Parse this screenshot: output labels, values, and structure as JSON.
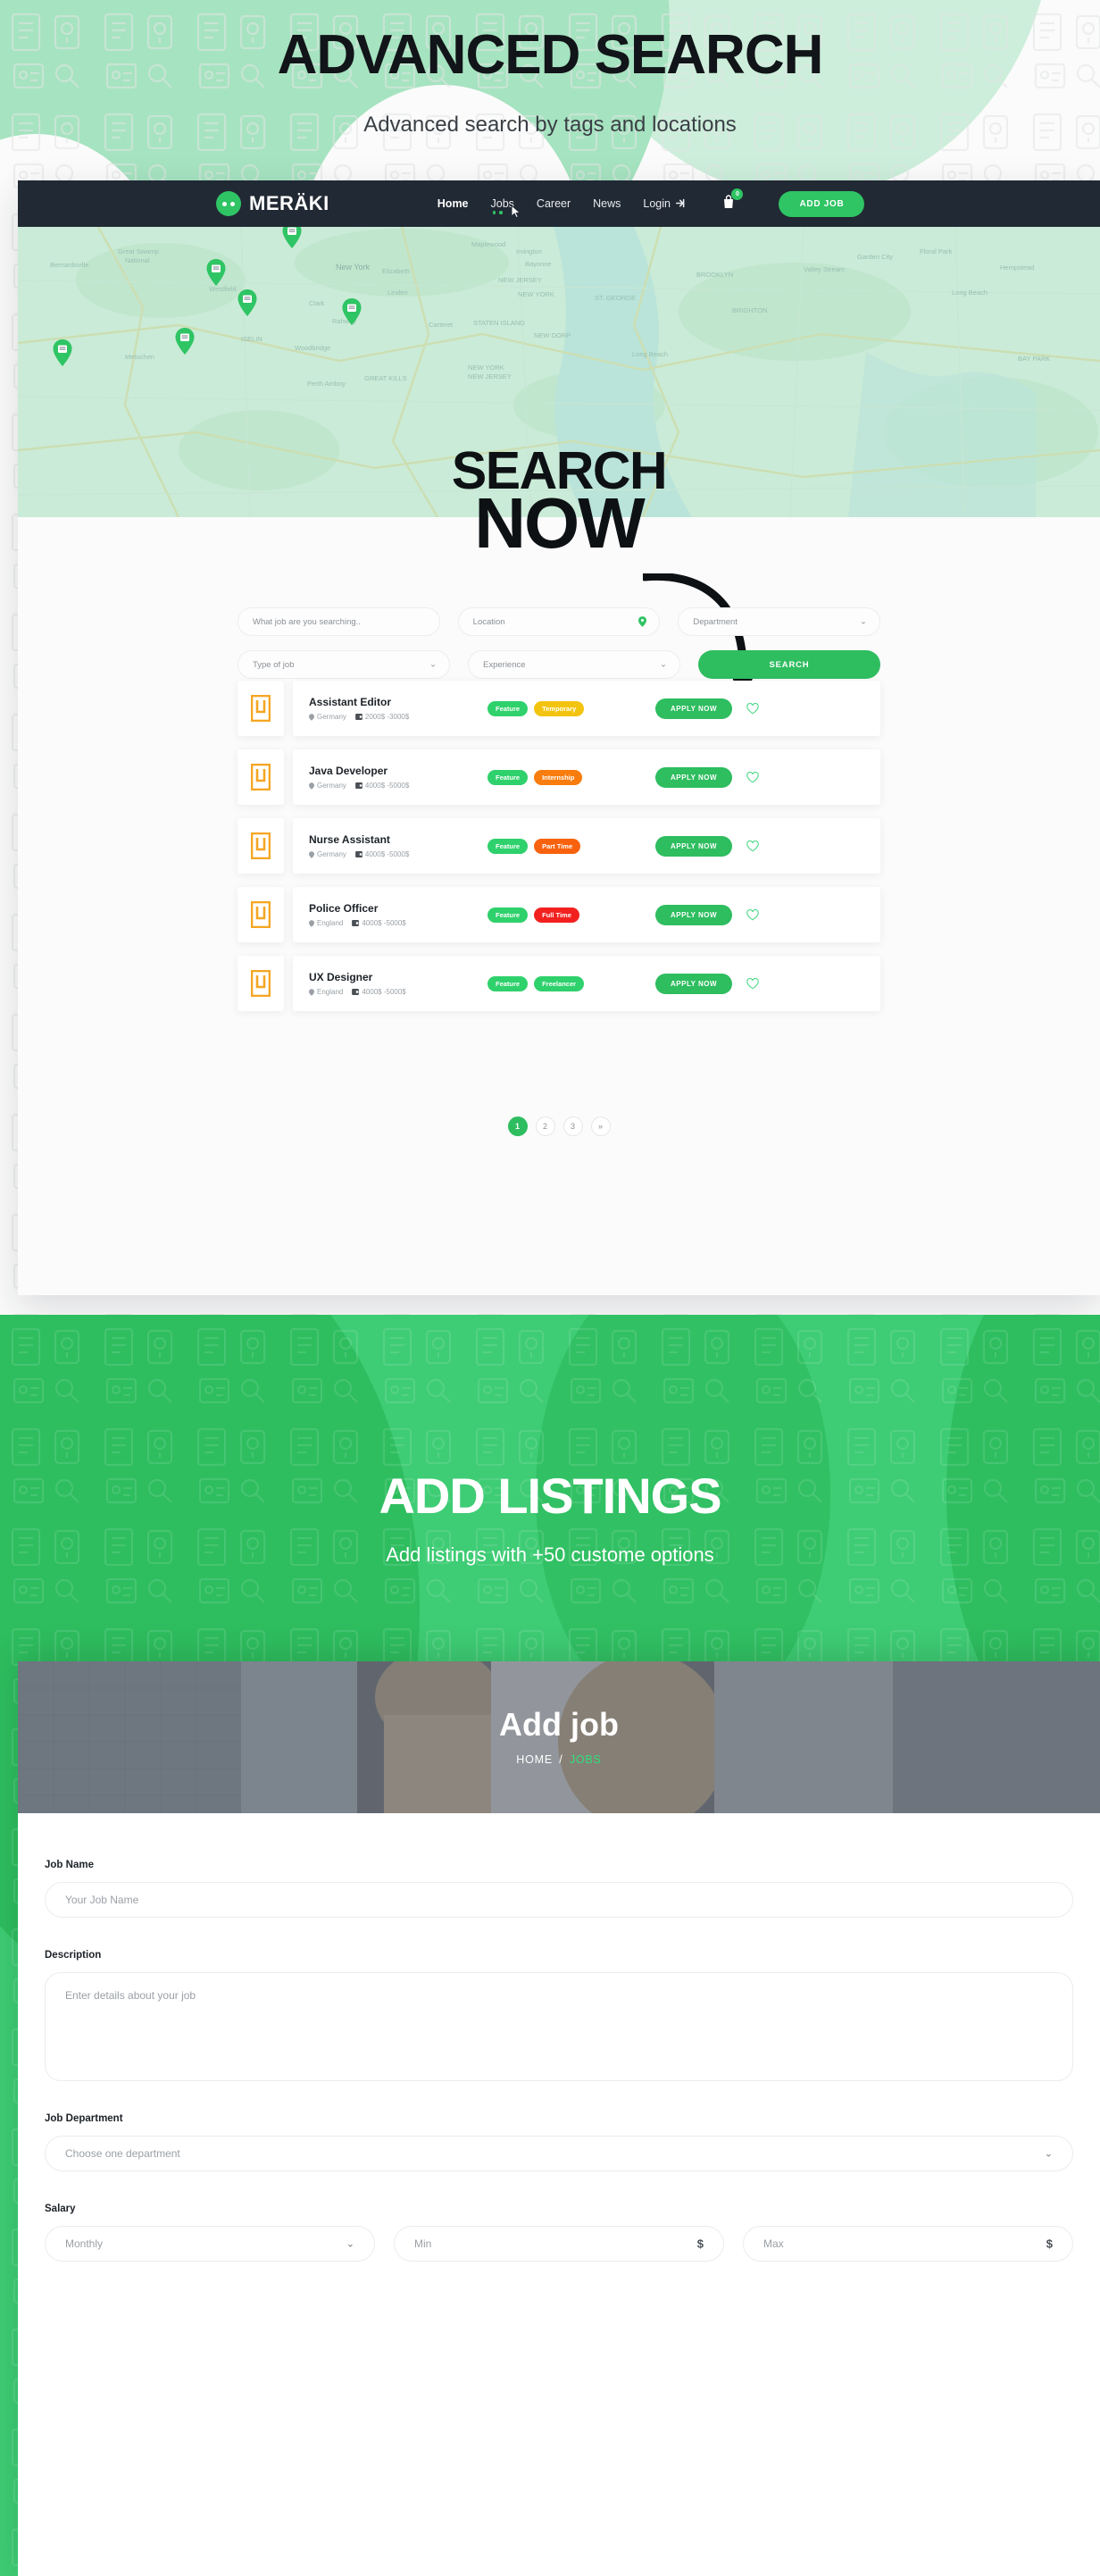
{
  "section1": {
    "title": "ADVANCED SEARCH",
    "subtitle": "Advanced search by tags and locations",
    "nav": {
      "brand": "MERÄKI",
      "links": [
        {
          "label": "Home",
          "active": true
        },
        {
          "label": "Jobs",
          "active": false
        },
        {
          "label": "Career",
          "active": false
        },
        {
          "label": "News",
          "active": false
        },
        {
          "label": "Login",
          "active": false
        }
      ],
      "cart_count": "0",
      "add_job_label": "ADD JOB"
    },
    "map": {
      "labels": [
        "New York",
        "Bernardsville",
        "Westfield",
        "Clark",
        "Rahway",
        "Elizabeth",
        "Bayonne",
        "NEW JERSEY",
        "NEW YORK",
        "ST. GEORGE",
        "STATEN ISLAND",
        "NEW DORP",
        "ISELIN",
        "Woodbridge",
        "Carteret",
        "Metuchen",
        "Perth Amboy",
        "Linden",
        "Maplewood",
        "Irvington",
        "BROOKLYN",
        "Long Beach",
        "Hempstead",
        "Garden City",
        "Floral Park"
      ],
      "pin_count": 6
    },
    "overlay": {
      "line1": "SEARCH",
      "line2": "NOW"
    },
    "search": {
      "keyword_placeholder": "What job are you searching..",
      "location_placeholder": "Location",
      "department_placeholder": "Department",
      "type_placeholder": "Type of job",
      "experience_placeholder": "Experience",
      "button_label": "SEARCH"
    },
    "jobs": [
      {
        "title": "Assistant Editor",
        "location": "Germany",
        "salary": "2000$ -3000$",
        "tags": [
          {
            "label": "Feature",
            "color": "#2fd16c"
          },
          {
            "label": "Temporary",
            "color": "#f3c40f"
          }
        ],
        "apply_label": "APPLY NOW"
      },
      {
        "title": "Java Developer",
        "location": "Germany",
        "salary": "4000$ -5000$",
        "tags": [
          {
            "label": "Feature",
            "color": "#2fd16c"
          },
          {
            "label": "Internship",
            "color": "#f87c0e"
          }
        ],
        "apply_label": "APPLY NOW"
      },
      {
        "title": "Nurse Assistant",
        "location": "Germany",
        "salary": "4000$ -5000$",
        "tags": [
          {
            "label": "Feature",
            "color": "#2fd16c"
          },
          {
            "label": "Part Time",
            "color": "#f8620e"
          }
        ],
        "apply_label": "APPLY NOW"
      },
      {
        "title": "Police Officer",
        "location": "England",
        "salary": "4000$ -5000$",
        "tags": [
          {
            "label": "Feature",
            "color": "#2fd16c"
          },
          {
            "label": "Full Time",
            "color": "#f2211f"
          }
        ],
        "apply_label": "APPLY NOW"
      },
      {
        "title": "UX Designer",
        "location": "England",
        "salary": "4000$ -5000$",
        "tags": [
          {
            "label": "Feature",
            "color": "#2fd16c"
          },
          {
            "label": "Freelancer",
            "color": "#2fd16c"
          }
        ],
        "apply_label": "APPLY NOW"
      }
    ],
    "pagination": [
      {
        "label": "1",
        "active": true
      },
      {
        "label": "2",
        "active": false
      },
      {
        "label": "3",
        "active": false
      },
      {
        "label": "»",
        "active": false
      }
    ]
  },
  "section2": {
    "title": "ADD LISTINGS",
    "subtitle": "Add listings with +50 custome options",
    "page_header": {
      "heading": "Add job",
      "breadcrumb_home": "HOME",
      "breadcrumb_separator": "/",
      "breadcrumb_current": "JOBS"
    },
    "form": {
      "job_name_label": "Job Name",
      "job_name_placeholder": "Your Job Name",
      "description_label": "Description",
      "description_placeholder": "Enter details about your job",
      "department_label": "Job Department",
      "department_placeholder": "Choose one department",
      "salary_label": "Salary",
      "salary_period_value": "Monthly",
      "salary_min_placeholder": "Min",
      "salary_max_placeholder": "Max",
      "currency_symbol": "$"
    }
  },
  "colors": {
    "brand_green": "#2fc464",
    "dark_nav": "#212934",
    "mint": "#a6e3c0",
    "section_green": "#3ecc74",
    "logo_orange": "#f5a623"
  }
}
